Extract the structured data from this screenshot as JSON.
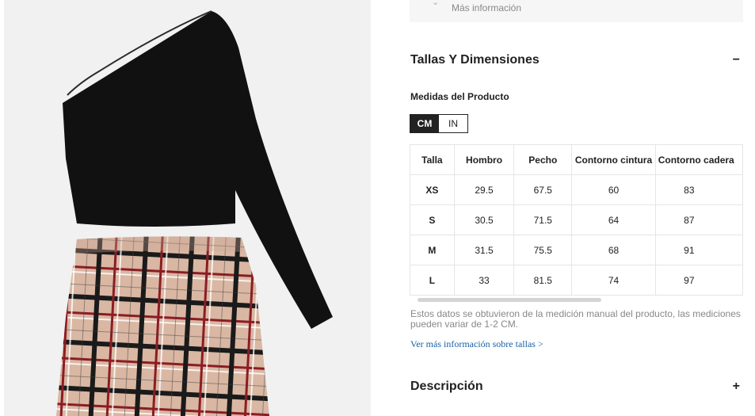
{
  "info_box": {
    "more_info": "Más información"
  },
  "sizes_section": {
    "title": "Tallas Y Dimensiones",
    "toggle": "−",
    "measure_title": "Medidas del Producto",
    "units": [
      "CM",
      "IN"
    ],
    "active_unit": "CM",
    "table": {
      "headers": [
        "Talla",
        "Hombro",
        "Pecho",
        "Contorno cintura",
        "Contorno cadera"
      ],
      "rows": [
        [
          "XS",
          "29.5",
          "67.5",
          "60",
          "83"
        ],
        [
          "S",
          "30.5",
          "71.5",
          "64",
          "87"
        ],
        [
          "M",
          "31.5",
          "75.5",
          "68",
          "91"
        ],
        [
          "L",
          "33",
          "81.5",
          "74",
          "97"
        ]
      ]
    },
    "note": "Estos datos se obtuvieron de la medición manual del producto, las mediciones pueden variar de 1-2 CM.",
    "more_link": "Ver más información sobre tallas >"
  },
  "description_section": {
    "title": "Descripción",
    "toggle": "+"
  },
  "colors": {
    "top": "#111111",
    "plaid_base": "#d9b7a3",
    "plaid_dark": "#1a1a1a",
    "plaid_red": "#8c1c24",
    "accent_dark": "#222222"
  }
}
